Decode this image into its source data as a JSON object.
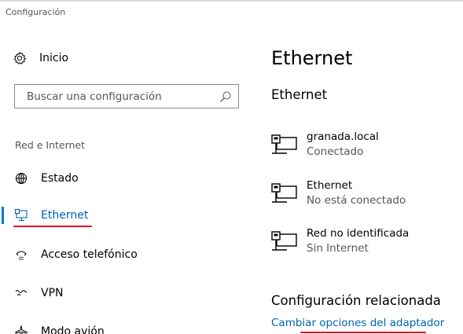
{
  "window": {
    "title": "Configuración"
  },
  "sidebar": {
    "home_label": "Inicio",
    "search": {
      "value": "",
      "placeholder": "Buscar una configuración"
    },
    "section_label": "Red e Internet",
    "items": [
      {
        "label": "Estado",
        "icon": "globe-icon",
        "active": false
      },
      {
        "label": "Ethernet",
        "icon": "ethernet-icon",
        "active": true
      },
      {
        "label": "Acceso telefónico",
        "icon": "dialup-icon",
        "active": false
      },
      {
        "label": "VPN",
        "icon": "vpn-icon",
        "active": false
      },
      {
        "label": "Modo avión",
        "icon": "airplane-icon",
        "active": false
      }
    ]
  },
  "main": {
    "title": "Ethernet",
    "subheading": "Ethernet",
    "networks": [
      {
        "name": "granada.local",
        "status": "Conectado",
        "icon": "network-monitor-icon"
      },
      {
        "name": "Ethernet",
        "status": "No está conectado",
        "icon": "network-monitor-icon"
      },
      {
        "name": "Red no identificada",
        "status": "Sin Internet",
        "icon": "network-monitor-icon"
      }
    ],
    "related_heading": "Configuración relacionada",
    "related_link": "Cambiar opciones del adaptador"
  },
  "colors": {
    "accent": "#0078d7",
    "link": "#0063b1",
    "annotation": "#e81123",
    "secondary_text": "#555555"
  }
}
